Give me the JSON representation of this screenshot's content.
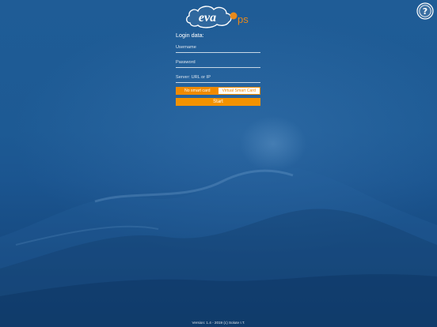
{
  "app": {
    "logo_text": "eva",
    "logo_suffix": "ps"
  },
  "login": {
    "section_title": "Login data:",
    "username_placeholder": "Username",
    "password_placeholder": "Password",
    "server_placeholder": "Server: URL or IP",
    "card_options": [
      {
        "label": "No smart card",
        "selected": true
      },
      {
        "label": "Virtual Smart Card",
        "selected": false
      }
    ],
    "start_label": "Start"
  },
  "help": {
    "icon": "help-icon"
  },
  "footer": {
    "version_text": "Version: 1.4 - 2019 (c) Solute I.T."
  },
  "colors": {
    "background": "#1d5a94",
    "accent": "#f39200",
    "logo_suffix": "#e8891a"
  }
}
